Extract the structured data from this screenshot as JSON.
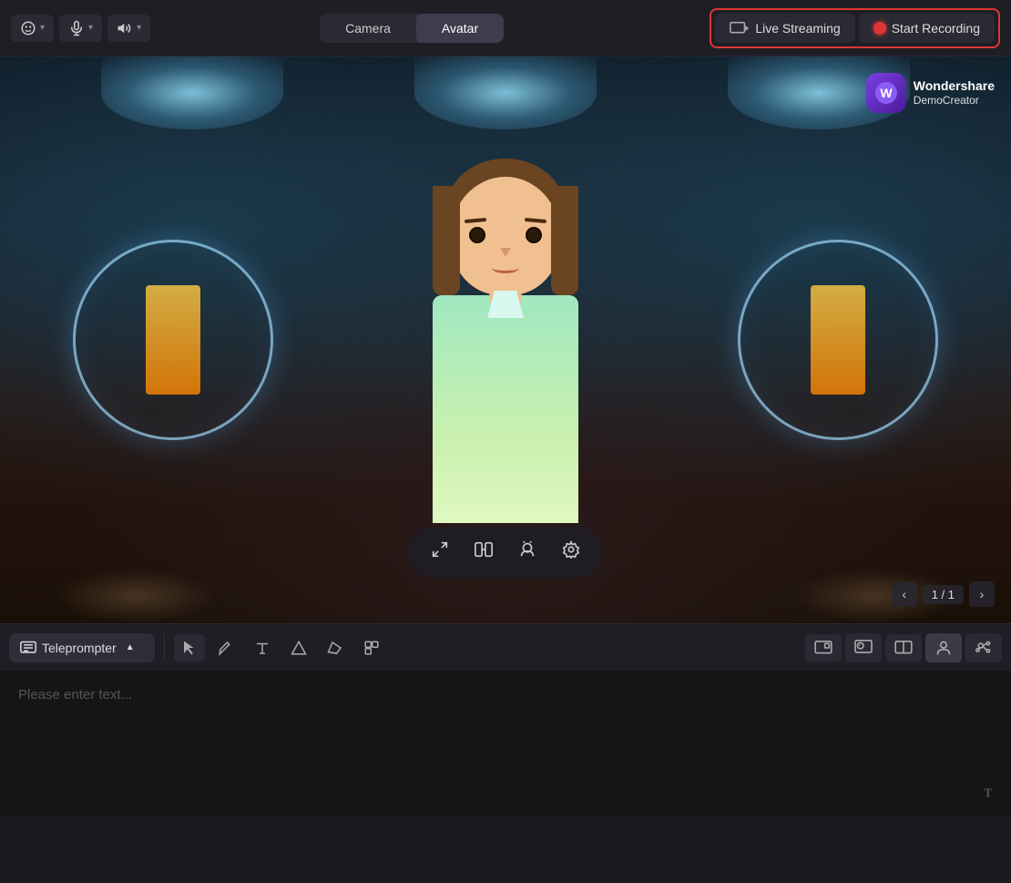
{
  "toolbar": {
    "camera_label": "Camera",
    "avatar_label": "Avatar",
    "live_streaming_label": "Live Streaming",
    "start_recording_label": "Start Recording",
    "active_tab": "avatar"
  },
  "video": {
    "pagination": "1 / 1",
    "brand_name": "Wondershare",
    "brand_sub": "DemoCreator",
    "brand_icon": "W"
  },
  "bottom": {
    "teleprompter_label": "Teleprompter",
    "text_placeholder": "Please enter text..."
  },
  "controls": {
    "prev_icon": "‹",
    "next_icon": "›"
  }
}
